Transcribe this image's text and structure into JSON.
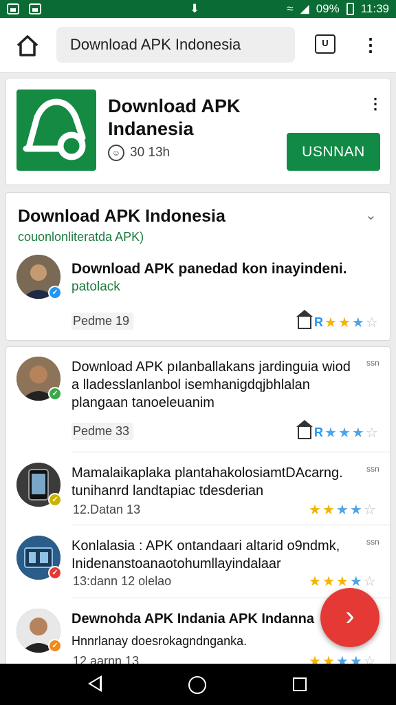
{
  "status_bar": {
    "battery": "09%",
    "time": "11:39"
  },
  "toolbar": {
    "search_text": "Download APK Indonesia",
    "tab_label": "U"
  },
  "app_card": {
    "title": "Download APK Indanesia",
    "meta": "30 13h",
    "install_label": "USNNAN",
    "brand_color": "#118a45"
  },
  "section": {
    "title": "Download APK Indonesia",
    "subtitle": "couonlonliteratda APK)",
    "first_review": {
      "title": "Download APK panedad kon inayindeni.",
      "subtitle": "patolack",
      "date": "Pedme 19"
    }
  },
  "reviews": [
    {
      "text": "Download APK pılanballakans jardinguia wiod a lladesslanlanbol isemhanigdqjbhlalan plangaan tanoeleuanim",
      "date": "Pedme 33",
      "time": "ssn",
      "bold_prefix": "Download APK"
    },
    {
      "text": "Mamalaikaplaka plantahakolosiamtDAcarng. tunihanrd landtapiac tdesderian",
      "date": "12.Datan 13",
      "time": "ssn"
    },
    {
      "text": "Konlalasia : APK ontandaari altarid o9ndmk, Inidenanstoanaotohumllayindalaar",
      "date": "13:dann 12 olelao",
      "time": "ssn"
    },
    {
      "text": "Dewnohda APK Indania APK Indanna",
      "subtext": "Hnnrlanay doesrokagndnganka.",
      "date": "12 aarnn 13",
      "time": ""
    }
  ],
  "icons": {
    "home": "home-icon",
    "tabs": "tabs-icon",
    "menu": "more-vertical-icon",
    "fab": "chevron-right-icon",
    "nav_back": "back-triangle-icon",
    "nav_home": "home-circle-icon",
    "nav_recent": "recents-square-icon"
  }
}
